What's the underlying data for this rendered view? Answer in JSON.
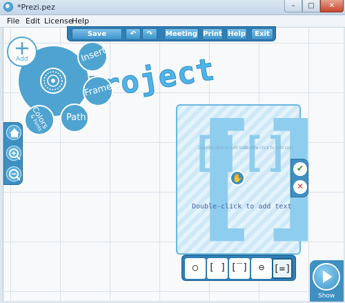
{
  "window": {
    "title": "*Prezi.pez",
    "min_label": "–",
    "max_label": "□",
    "close_label": "✕"
  },
  "menu": {
    "items": [
      "File",
      "Edit",
      "License",
      "Help"
    ]
  },
  "toolbar": {
    "save": "Save",
    "undo": "↶",
    "redo": "↷",
    "meeting": "Meeting",
    "print": "Print",
    "help": "Help",
    "exit": "Exit"
  },
  "bubble_menu": {
    "add_label": "Add",
    "insert": "Insert",
    "frame": "Frame",
    "path": "Path",
    "colors": "Colors",
    "colors_sub": "& Fonts"
  },
  "canvas": {
    "project_text": "Project"
  },
  "frame": {
    "placeholder_left": "Double-click to add text",
    "placeholder_right": "Double-click to add text",
    "main_text": "Double-click to add text"
  },
  "frame_selector": {
    "items": [
      "○",
      "[ ]",
      "[‾]",
      "⊖",
      "[=]"
    ]
  },
  "confirm": {
    "ok": "✔",
    "cancel": "✕"
  },
  "show": {
    "label": "Show"
  },
  "colors": {
    "accent": "#3e8fc2",
    "bubble": "#4fa3d0",
    "project_text": "#4fb4e8"
  }
}
